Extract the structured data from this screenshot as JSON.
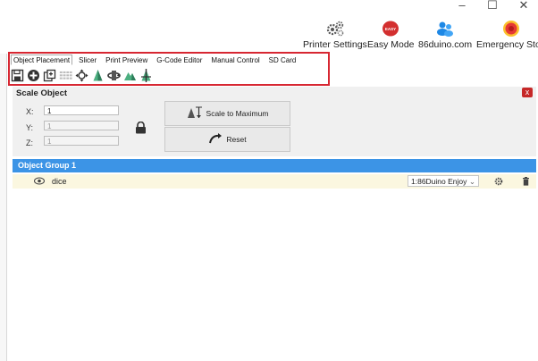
{
  "window": {
    "minimize": "–",
    "maximize": "☐",
    "close": "✕"
  },
  "toolbar": [
    {
      "label": "Printer Settings",
      "icon": "gears-icon"
    },
    {
      "label": "Easy Mode",
      "icon": "easy-mode-icon",
      "badge": "EASY"
    },
    {
      "label": "86duino.com",
      "icon": "users-icon"
    },
    {
      "label": "Emergency Stop",
      "icon": "emergency-stop-icon"
    }
  ],
  "tabs": [
    {
      "label": "Object Placement",
      "active": true
    },
    {
      "label": "Slicer"
    },
    {
      "label": "Print Preview"
    },
    {
      "label": "G-Code Editor"
    },
    {
      "label": "Manual Control"
    },
    {
      "label": "SD Card"
    }
  ],
  "icon_row": [
    "save-icon",
    "add-icon",
    "copy-icon",
    "grid-icon",
    "move-icon",
    "cone-icon",
    "rotate-icon",
    "mountain-icon",
    "cut-icon"
  ],
  "scale_panel": {
    "title": "Scale Object",
    "close_label": "x",
    "x_label": "X:",
    "x_value": "1",
    "y_label": "Y:",
    "y_value": "1",
    "z_label": "Z:",
    "z_value": "1",
    "scale_max_label": "Scale to Maximum",
    "reset_label": "Reset"
  },
  "group": {
    "title": "Object Group 1"
  },
  "objects": [
    {
      "name": "dice",
      "printer": "1:86Duino Enjoy"
    }
  ],
  "colors": {
    "accent": "#3c94e6",
    "highlight": "#d72732",
    "row_bg": "#fbf7e0"
  }
}
